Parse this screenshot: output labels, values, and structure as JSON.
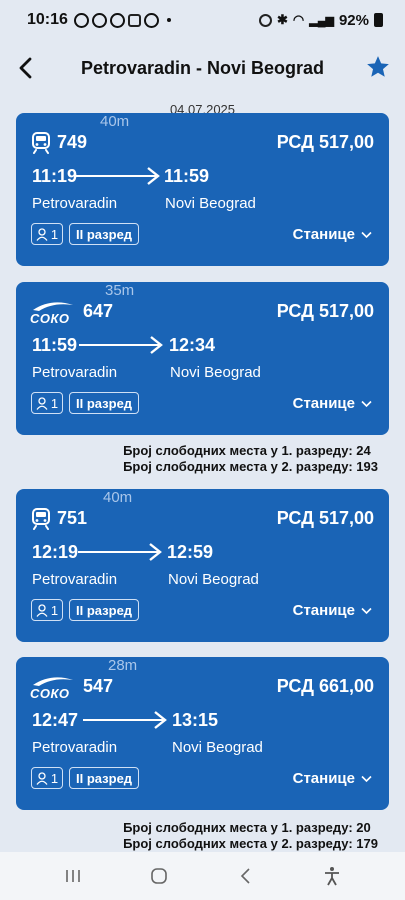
{
  "status_bar": {
    "time": "10:16",
    "battery": "92%"
  },
  "header": {
    "title": "Petrovaradin - Novi Beograd",
    "back_icon": "back-arrow-icon",
    "favorite_icon": "star-icon"
  },
  "date": "04.07.2025",
  "colors": {
    "card_bg": "#1a64b6",
    "page_bg": "#e3e9f2",
    "accent": "#1a64b6"
  },
  "trains": [
    {
      "type_icon": "train-icon",
      "number": "749",
      "price": "РСД 517,00",
      "departure": "11:19",
      "duration": "40m",
      "arrival": "11:59",
      "from": "Petrovaradin",
      "to": "Novi Beograd",
      "passengers": "1",
      "class_label": "II разред",
      "stations_label": "Станице"
    },
    {
      "type_icon": "soko-icon",
      "soko_label": "СОКО",
      "number": "647",
      "price": "РСД 517,00",
      "departure": "11:59",
      "duration": "35m",
      "arrival": "12:34",
      "from": "Petrovaradin",
      "to": "Novi Beograd",
      "passengers": "1",
      "class_label": "II разред",
      "stations_label": "Станице",
      "seats_1": "Број слободних места у 1. разреду: 24",
      "seats_2": "Број слободних места у 2. разреду: 193"
    },
    {
      "type_icon": "train-icon",
      "number": "751",
      "price": "РСД 517,00",
      "departure": "12:19",
      "duration": "40m",
      "arrival": "12:59",
      "from": "Petrovaradin",
      "to": "Novi Beograd",
      "passengers": "1",
      "class_label": "II разред",
      "stations_label": "Станице"
    },
    {
      "type_icon": "soko-icon",
      "soko_label": "СОКО",
      "number": "547",
      "price": "РСД 661,00",
      "departure": "12:47",
      "duration": "28m",
      "arrival": "13:15",
      "from": "Petrovaradin",
      "to": "Novi Beograd",
      "passengers": "1",
      "class_label": "II разред",
      "stations_label": "Станице",
      "seats_1": "Број слободних места у 1. разреду: 20",
      "seats_2": "Број слободних места у 2. разреду: 179"
    }
  ],
  "nav_bar": {
    "recent": "recent-apps-icon",
    "home": "home-icon",
    "back": "back-icon",
    "accessibility": "accessibility-icon"
  }
}
